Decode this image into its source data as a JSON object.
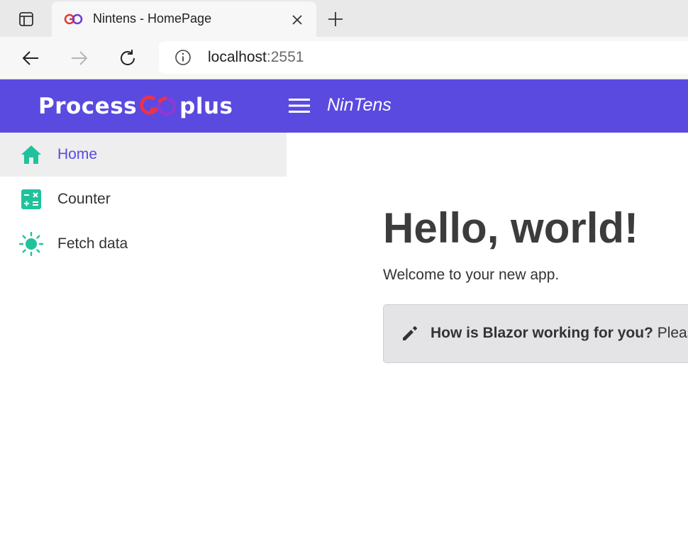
{
  "browser": {
    "tab_title": "Nintens - HomePage",
    "url_host": "localhost",
    "url_port": ":2551"
  },
  "header": {
    "brand_left": "Process",
    "brand_right": "plus",
    "app_title": "NinTens",
    "color": "#5a4ae0"
  },
  "sidebar": {
    "items": [
      {
        "label": "Home",
        "icon": "home-icon",
        "active": true
      },
      {
        "label": "Counter",
        "icon": "calculator-icon",
        "active": false
      },
      {
        "label": "Fetch data",
        "icon": "sun-icon",
        "active": false
      }
    ]
  },
  "main": {
    "heading": "Hello, world!",
    "welcome": "Welcome to your new app.",
    "survey_bold": "How is Blazor working for you?",
    "survey_rest": "Pleas"
  },
  "colors": {
    "accent": "#5a4ae0",
    "icon_teal": "#1fc29b"
  }
}
